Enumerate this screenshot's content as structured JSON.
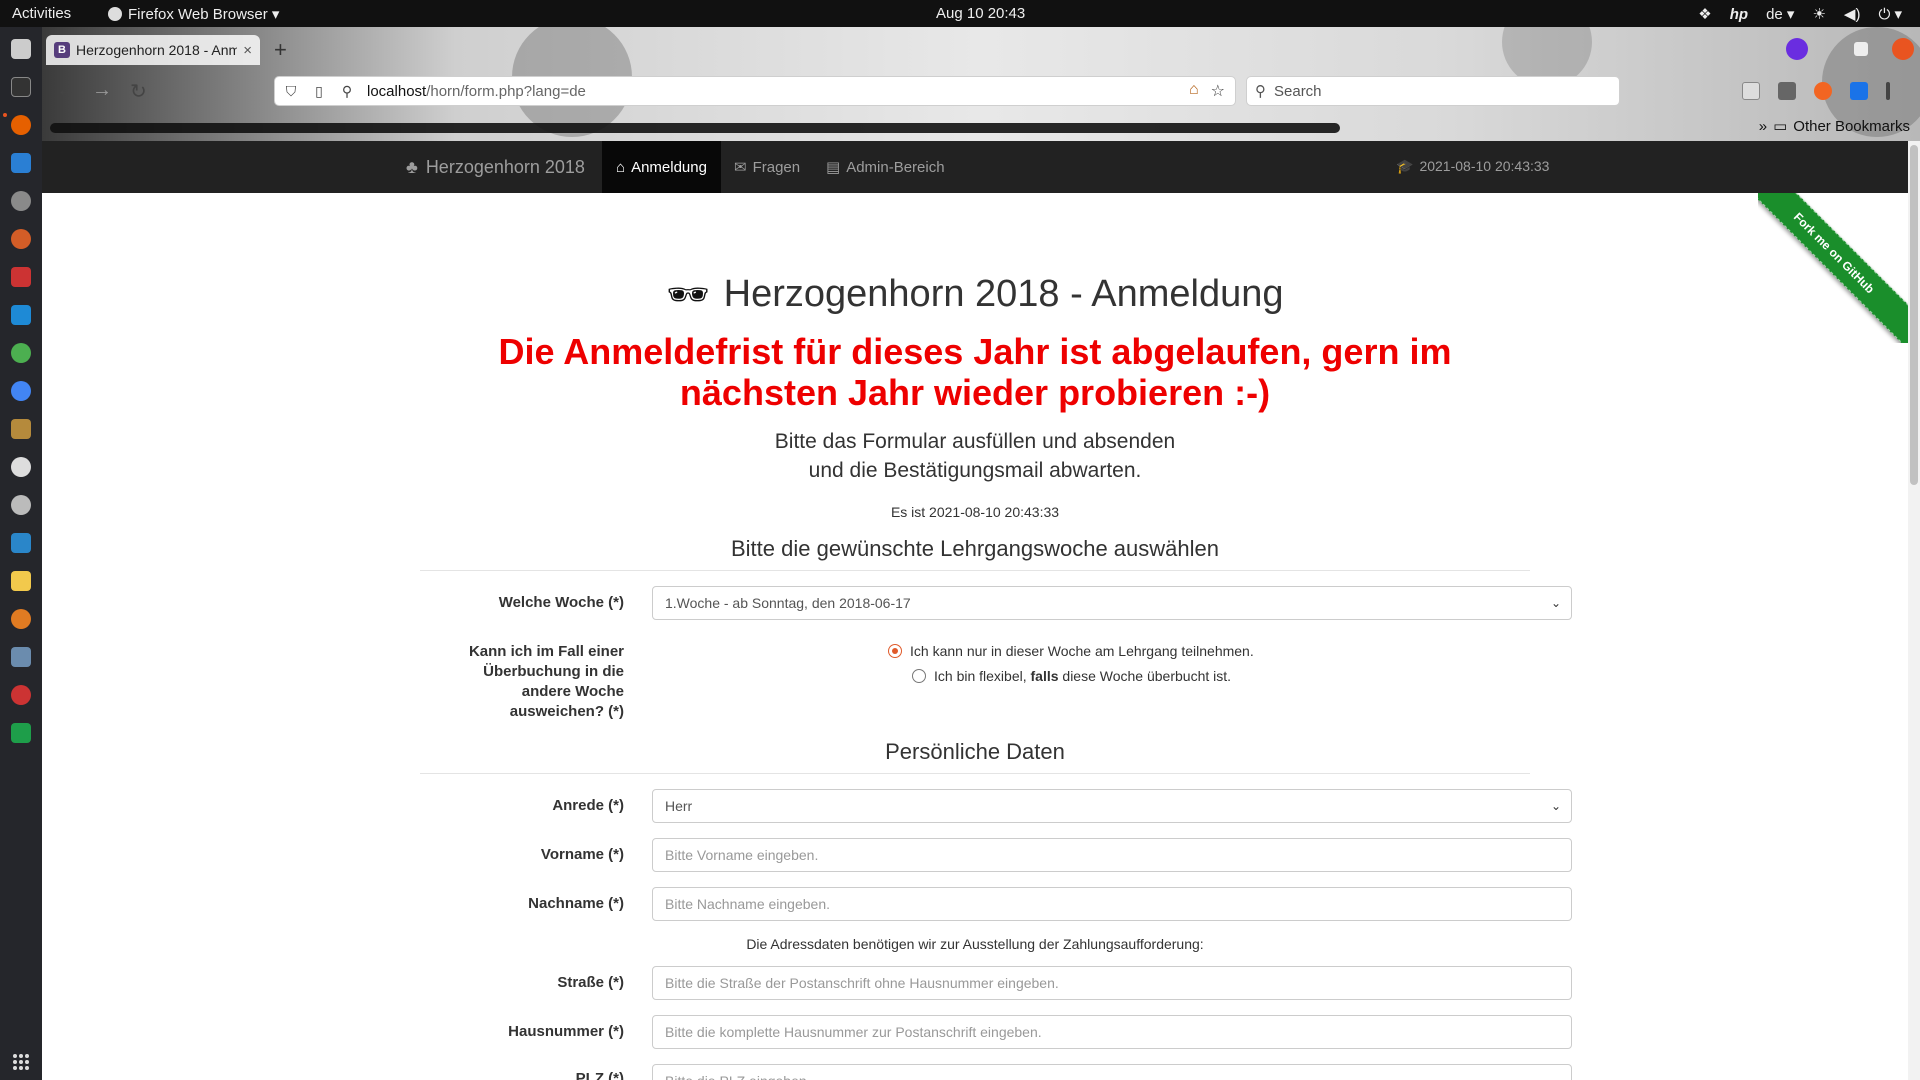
{
  "os": {
    "activities": "Activities",
    "app_menu": "Firefox Web Browser ▾",
    "clock": "Aug 10  20:43",
    "keyboard_layout": "de ▾"
  },
  "browser": {
    "tab": {
      "favicon": "B",
      "title": "Herzogenhorn 2018 - Anm",
      "close": "×"
    },
    "new_tab": "+",
    "url_host": "localhost",
    "url_path": "/horn/form.php?lang=de",
    "search_placeholder": "Search",
    "other_bookmarks": "Other Bookmarks"
  },
  "site": {
    "brand": "Herzogenhorn 2018",
    "nav": [
      {
        "label": "Anmeldung",
        "icon": "⌂"
      },
      {
        "label": "Fragen",
        "icon": "✉"
      },
      {
        "label": "Admin-Bereich",
        "icon": "▤"
      }
    ],
    "timestamp": "2021-08-10 20:43:33",
    "ribbon": "Fork me on GitHub"
  },
  "content": {
    "heading": "Herzogenhorn 2018 - Anmeldung",
    "deadline_line1": "Die Anmeldefrist für dieses Jahr ist abgelaufen, gern im",
    "deadline_line2": "nächsten Jahr wieder probieren :-)",
    "instr_line1": "Bitte das Formular ausfüllen und absenden",
    "instr_line2": "und die Bestätigungsmail abwarten.",
    "now": "Es ist 2021-08-10 20:43:33",
    "section_week": "Bitte die gewünschte Lehrgangswoche auswählen",
    "section_personal": "Persönliche Daten",
    "address_note": "Die Adressdaten benötigen wir zur Ausstellung der Zahlungsaufforderung:"
  },
  "form": {
    "week": {
      "label": "Welche Woche (*)",
      "value": "1.Woche - ab Sonntag, den 2018-06-17"
    },
    "flex": {
      "label_lines": [
        "Kann ich im Fall einer",
        "Überbuchung in die",
        "andere Woche",
        "ausweichen? (*)"
      ],
      "opt1": "Ich kann nur in dieser Woche am Lehrgang teilnehmen.",
      "opt2_pre": "Ich bin flexibel, ",
      "opt2_bold": "falls",
      "opt2_post": " diese Woche überbucht ist."
    },
    "salutation": {
      "label": "Anrede (*)",
      "value": "Herr"
    },
    "firstname": {
      "label": "Vorname (*)",
      "placeholder": "Bitte Vorname eingeben."
    },
    "lastname": {
      "label": "Nachname (*)",
      "placeholder": "Bitte Nachname eingeben."
    },
    "street": {
      "label": "Straße (*)",
      "placeholder": "Bitte die Straße der Postanschrift ohne Hausnummer eingeben."
    },
    "housenr": {
      "label": "Hausnummer (*)",
      "placeholder": "Bitte die komplette Hausnummer zur Postanschrift eingeben."
    },
    "zip": {
      "label": "PLZ (*)",
      "placeholder": "Bitte die PLZ eingeben."
    }
  },
  "colors": {
    "deadline": "#ee0000",
    "navbar": "#222222",
    "ribbon": "#1a8e2b",
    "radio_accent": "#e05a2a"
  }
}
